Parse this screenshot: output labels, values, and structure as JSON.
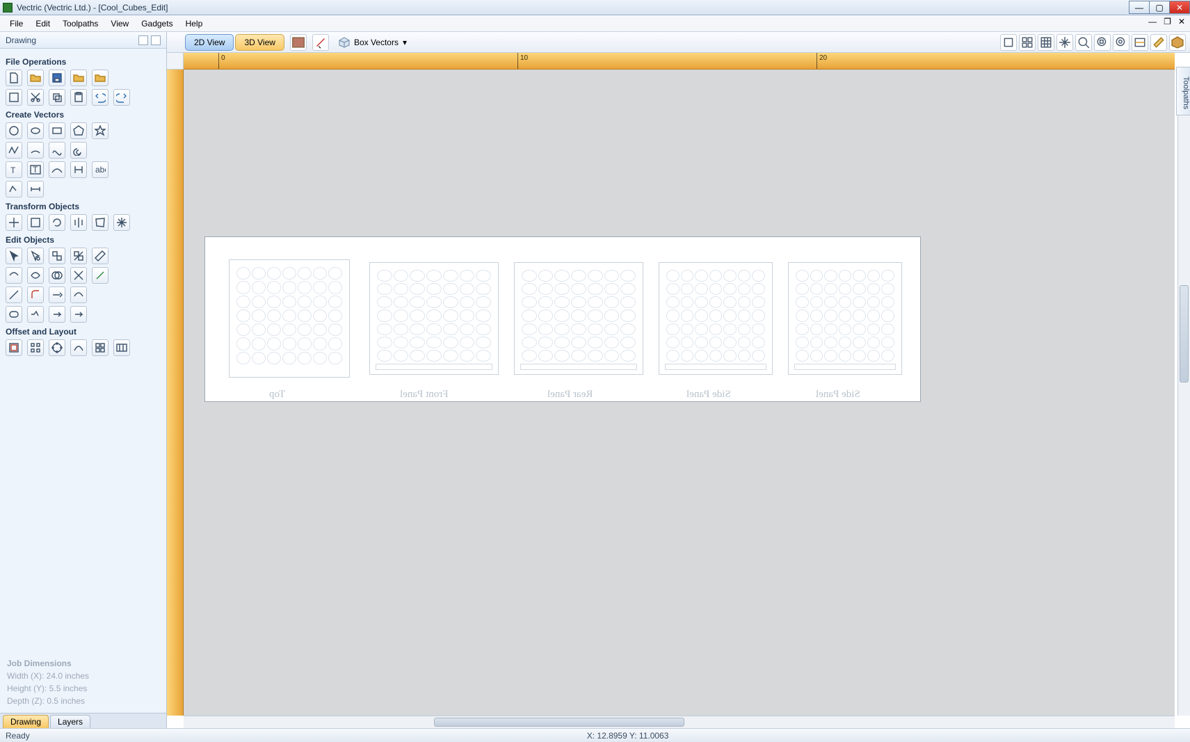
{
  "window": {
    "title": "Vectric (Vectric Ltd.) - [Cool_Cubes_Edit]"
  },
  "menubar": [
    "File",
    "Edit",
    "Toolpaths",
    "View",
    "Gadgets",
    "Help"
  ],
  "sidebar": {
    "panel_title": "Drawing",
    "sections": {
      "file_ops": "File Operations",
      "create_vectors": "Create Vectors",
      "transform": "Transform Objects",
      "edit_objects": "Edit Objects",
      "offset_layout": "Offset and Layout"
    },
    "tabs": {
      "drawing": "Drawing",
      "layers": "Layers"
    }
  },
  "job_dimensions": {
    "title": "Job Dimensions",
    "width": "Width  (X): 24.0 inches",
    "height": "Height (Y): 5.5 inches",
    "depth": "Depth  (Z): 0.5 inches"
  },
  "view_tabs": {
    "v2d": "2D View",
    "v3d": "3D View"
  },
  "toolbar": {
    "box_vectors": "Box Vectors"
  },
  "ruler": {
    "majors": [
      0,
      10,
      20
    ]
  },
  "panels": {
    "labels": [
      "Top",
      "Front Panel",
      "Rear Panel",
      "Side Panel",
      "Side Panel"
    ]
  },
  "right_rail": {
    "toolpaths": "Toolpaths"
  },
  "status": {
    "ready": "Ready",
    "coords": "X: 12.8959 Y: 11.0063"
  }
}
